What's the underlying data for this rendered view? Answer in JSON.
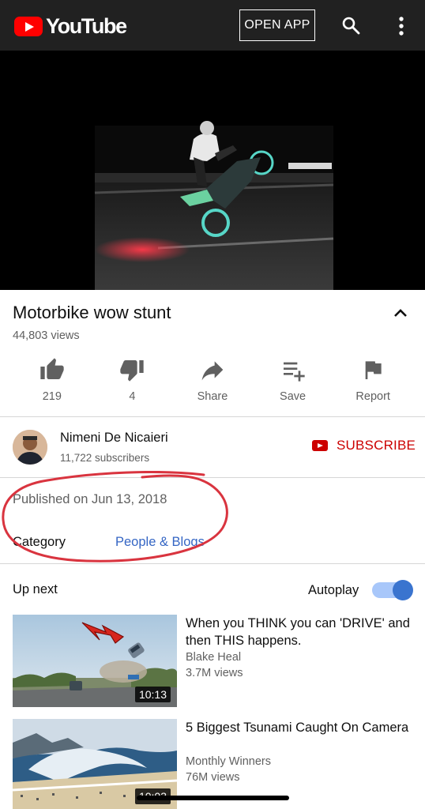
{
  "header": {
    "logo_text": "YouTube",
    "open_app_label": "OPEN APP",
    "search_icon": "search-icon",
    "more_icon": "more-vertical-icon"
  },
  "video": {
    "title": "Motorbike wow stunt",
    "views": "44,803 views"
  },
  "actions": [
    {
      "icon": "thumbs-up-icon",
      "label": "219"
    },
    {
      "icon": "thumbs-down-icon",
      "label": "4"
    },
    {
      "icon": "share-icon",
      "label": "Share"
    },
    {
      "icon": "playlist-add-icon",
      "label": "Save"
    },
    {
      "icon": "flag-icon",
      "label": "Report"
    }
  ],
  "channel": {
    "name": "Nimeni De Nicaieri",
    "subscribers": "11,722 subscribers",
    "subscribe_label": "SUBSCRIBE"
  },
  "details": {
    "published": "Published on Jun 13, 2018",
    "category_label": "Category",
    "category_value": "People & Blogs"
  },
  "upnext": {
    "label": "Up next",
    "autoplay_label": "Autoplay",
    "autoplay_on": true,
    "videos": [
      {
        "title": "When you THINK you can 'DRIVE' and then THIS happens.",
        "channel": "Blake Heal",
        "views": "3.7M views",
        "duration": "10:13"
      },
      {
        "title": "5 Biggest Tsunami Caught On Camera",
        "channel": "Monthly Winners",
        "views": "76M views",
        "duration": "10:03"
      }
    ]
  },
  "colors": {
    "topbar": "#212121",
    "brand_red": "#ff0000",
    "subscribe_red": "#cc0000",
    "link_blue": "#3566c4",
    "annotation_red": "#d9343f",
    "toggle_blue": "#3a74cf"
  }
}
